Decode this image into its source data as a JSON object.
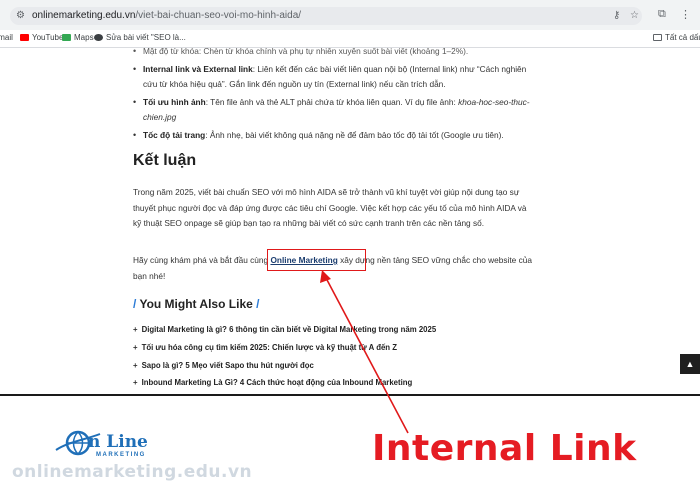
{
  "browser": {
    "url_host": "onlinemarketing.edu.vn",
    "url_path": "/viet-bai-chuan-seo-voi-mo-hinh-aida/",
    "bookmarks": [
      {
        "label": "Gmail",
        "color": "#ea4335"
      },
      {
        "label": "YouTube",
        "color": "#ff0000"
      },
      {
        "label": "Maps",
        "color": "#34a853"
      },
      {
        "label": "Sửa bài viết \"SEO là...",
        "color": "#3c4043"
      }
    ],
    "bookmarks_right": "Tất cả dấu tr"
  },
  "article": {
    "bullet_top_cut": "Mật độ từ khóa: Chèn từ khóa chính và phụ tự nhiên xuyên suốt bài viết (khoảng 1–2%).",
    "bullets": [
      {
        "bold": "Internal link và External link",
        "text": ": Liên kết đến các bài viết liên quan nội bộ (Internal link) như “Cách nghiên cứu từ khóa hiệu quả”. Gắn link đến nguồn uy tín (External link) nếu cần trích dẫn."
      },
      {
        "bold": "Tối ưu hình ảnh",
        "text": ": Tên file ảnh và thẻ ALT phải chứa từ khóa liên quan. Ví dụ file ảnh: ",
        "italic": "khoa-hoc-seo-thuc-chien.jpg"
      },
      {
        "bold": "Tốc độ tải trang",
        "text": ": Ảnh nhẹ, bài viết không quá nặng nề để đảm bảo tốc độ tải tốt (Google ưu tiên)."
      }
    ],
    "heading": "Kết luận",
    "conclusion": "Trong năm 2025, viết bài chuẩn SEO với mô hình AIDA sẽ trở thành vũ khí tuyệt vời giúp nội dung tạo sự thuyết phục người đọc và đáp ứng được các tiêu chí Google. Việc kết hợp các yếu tố của mô hình AIDA và kỹ thuật SEO onpage sẽ giúp bạn tạo ra những bài viết có sức cạnh tranh trên các nền tảng số.",
    "cta_before": "Hãy cùng khám phá và bắt đầu cùng ",
    "cta_link": "Online Marketing",
    "cta_after": " xây dựng nền tảng SEO vững chắc cho website của bạn nhé!",
    "related_title": "You Might Also Like",
    "related": [
      "Digital Marketing là gì? 6 thông tin cần biết về Digital Marketing trong năm 2025",
      "Tối ưu hóa công cụ tìm kiếm 2025: Chiến lược và kỹ thuật từ A đến Z",
      "Sapo là gì? 5 Mẹo viết Sapo thu hút người đọc",
      "Inbound Marketing Là Gì? 4 Cách thức hoạt động của Inbound Marketing"
    ]
  },
  "footer": {
    "logo_title": "n Line",
    "logo_sub": "MARKETING",
    "domain": "onlinemarketing.edu.vn",
    "annotation": "Internal Link"
  },
  "colors": {
    "accent_red": "#e51c23",
    "logo_blue": "#1f6fb8",
    "link_blue": "#1a3c6e"
  }
}
